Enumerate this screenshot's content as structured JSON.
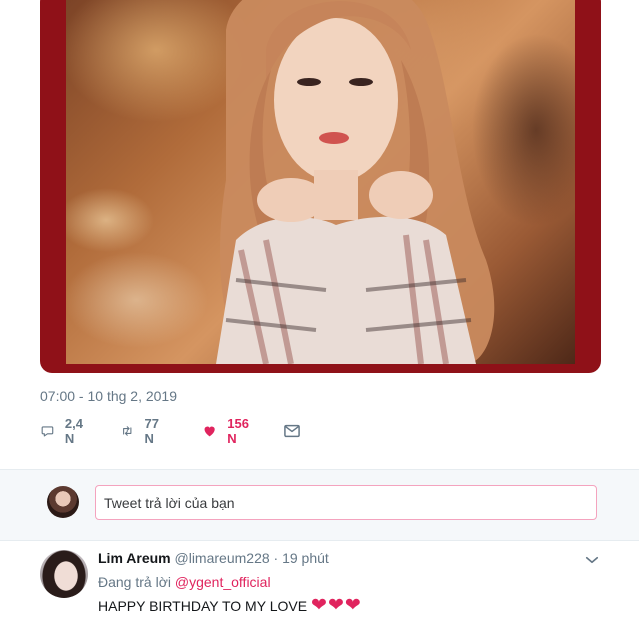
{
  "tweet": {
    "timestamp": "07:00 - 10 thg 2, 2019",
    "actions": {
      "reply": {
        "icon": "reply-icon",
        "count": "2,4 N"
      },
      "retweet": {
        "icon": "retweet-icon",
        "count": "77 N"
      },
      "like": {
        "icon": "heart-icon",
        "count": "156 N",
        "color": "#e0245e"
      },
      "dm": {
        "icon": "envelope-icon"
      }
    }
  },
  "reply_box": {
    "placeholder": "Tweet trả lời của bạn"
  },
  "reply_tweet": {
    "author_name": "Lim Areum",
    "handle": "@limareum228",
    "separator": "·",
    "time": "19 phút",
    "replying_label": "Đang trả lời",
    "mention": "@ygent_official",
    "text": "HAPPY BIRTHDAY TO MY LOVE",
    "emoji": [
      "❤",
      "❤",
      "❤"
    ]
  },
  "colors": {
    "accent": "#e0245e",
    "muted_text": "#657786",
    "frame_red": "#8f1118"
  }
}
